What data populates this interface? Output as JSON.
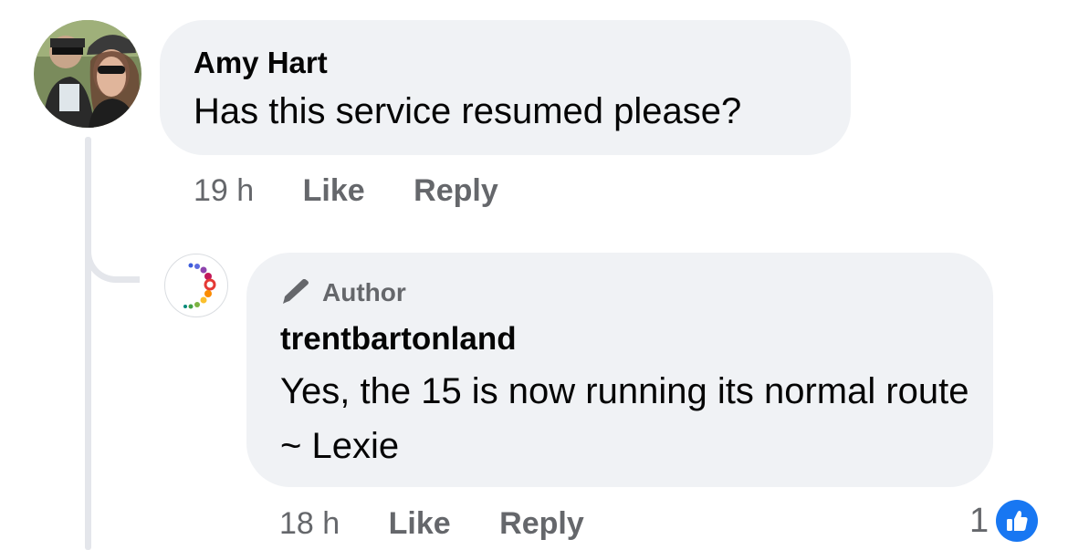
{
  "comment": {
    "author": "Amy Hart",
    "text": "Has this service resumed please?",
    "time": "19 h",
    "like_label": "Like",
    "reply_label": "Reply"
  },
  "reply": {
    "badge": "Author",
    "author": "trentbartonland",
    "text": "Yes, the 15 is now running its normal route ~ Lexie",
    "time": "18 h",
    "like_label": "Like",
    "reply_label": "Reply",
    "reaction_count": "1",
    "reaction_icon": "thumbs-up-icon"
  },
  "colors": {
    "bubble": "#f0f2f5",
    "secondary_text": "#65676b",
    "like_blue": "#1877f2"
  }
}
